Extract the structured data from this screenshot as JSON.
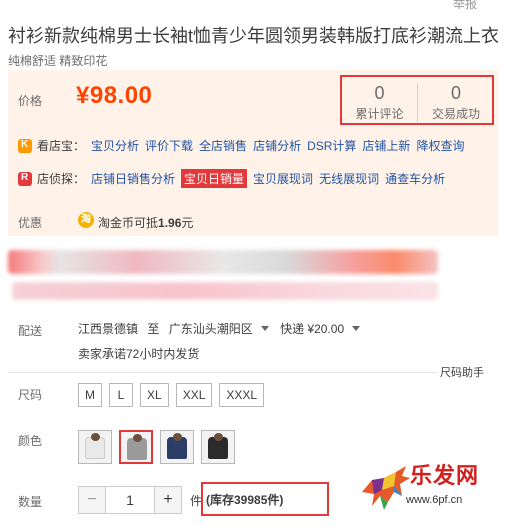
{
  "header": {
    "report_link": "举报",
    "title": "衬衫新款纯棉男士长袖t恤青少年圆领男装韩版打底衫潮流上衣服",
    "subtitle": "纯棉舒适 精致印花"
  },
  "price": {
    "label": "价格",
    "value": "¥98.00",
    "reviews_count": "0",
    "reviews_label": "累计评论",
    "deals_count": "0",
    "deals_label": "交易成功"
  },
  "tools": {
    "kandianbao": {
      "name": "看店宝：",
      "links": [
        "宝贝分析",
        "评价下载",
        "全店销售",
        "店铺分析",
        "DSR计算",
        "店铺上新",
        "降权查询"
      ]
    },
    "dianzhentan": {
      "name": "店侦探：",
      "links": [
        "店铺日销售分析",
        "宝贝日销量",
        "宝贝展现词",
        "无线展现词",
        "通查车分析"
      ],
      "highlight_index": 1
    }
  },
  "promo": {
    "label": "优惠",
    "coin_icon_text": "淘",
    "text_prefix": "淘金币可抵",
    "amount": "1.96",
    "text_suffix": "元"
  },
  "shipping": {
    "label": "配送",
    "origin": "江西景德镇",
    "to_word": "至",
    "destination": "广东汕头潮阳区",
    "method": "快递 ¥20.00",
    "promise": "卖家承诺72小时内发货"
  },
  "size_helper": "尺码助手",
  "sizes": {
    "label": "尺码",
    "options": [
      "M",
      "L",
      "XL",
      "XXL",
      "XXXL"
    ]
  },
  "colors": {
    "label": "颜色",
    "swatches": [
      {
        "name": "white",
        "color": "#e9e9e9"
      },
      {
        "name": "gray",
        "color": "#9a9a9a"
      },
      {
        "name": "navy",
        "color": "#2c3e66"
      },
      {
        "name": "black",
        "color": "#2b2b2b"
      }
    ],
    "selected_index": 1
  },
  "quantity": {
    "label": "数量",
    "minus": "−",
    "value": "1",
    "plus": "+",
    "unit": "件",
    "stock": "(库存39985件)"
  },
  "watermark": {
    "text": "乐发网",
    "url": "www.6pf.cn"
  },
  "accent_colors": {
    "price": "#ff4400",
    "highlight_box": "#e4393c",
    "link": "#2254a5",
    "panel_bg": "#fff2e8"
  }
}
